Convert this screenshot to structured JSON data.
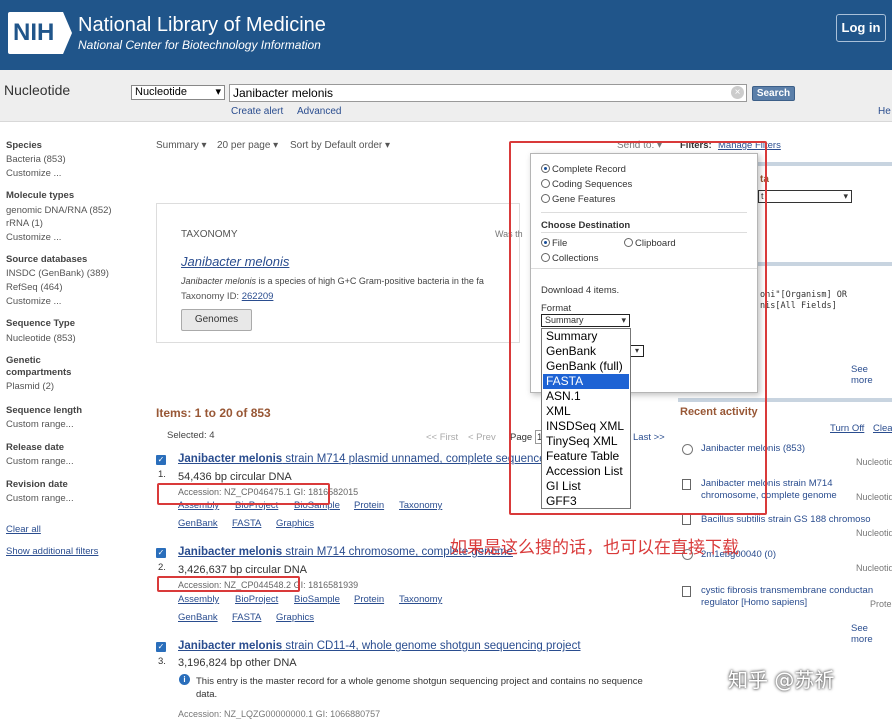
{
  "header": {
    "logo": "NIH",
    "org": "National Library of Medicine",
    "sub": "National Center for Biotechnology Information",
    "login": "Log in"
  },
  "search": {
    "db_name": "Nucleotide",
    "db_select": "Nucleotide",
    "query": "Janibacter melonis",
    "button": "Search",
    "create_alert": "Create alert",
    "advanced": "Advanced",
    "help": "He"
  },
  "filters": {
    "species_h": "Species",
    "species": [
      "Bacteria (853)",
      "Customize ..."
    ],
    "mol_h": "Molecule types",
    "mol": [
      "genomic DNA/RNA (852)",
      "rRNA (1)",
      "Customize ..."
    ],
    "src_h": "Source databases",
    "src": [
      "INSDC (GenBank) (389)",
      "RefSeq (464)",
      "Customize ..."
    ],
    "seqtype_h": "Sequence Type",
    "seqtype": [
      "Nucleotide (853)"
    ],
    "genetic_h1": "Genetic",
    "genetic_h2": "compartments",
    "genetic": [
      "Plasmid (2)"
    ],
    "seqlen_h": "Sequence length",
    "seqlen": [
      "Custom range..."
    ],
    "release_h": "Release date",
    "release": [
      "Custom range..."
    ],
    "revision_h": "Revision date",
    "revision": [
      "Custom range..."
    ],
    "clear_all": "Clear all",
    "show_add": "Show additional filters"
  },
  "toolbar": {
    "summary": "Summary ▾",
    "perpage": "20 per page ▾",
    "sort": "Sort by Default order ▾",
    "send_to": "Send to: ▾",
    "filters_label": "Filters:",
    "manage_filters": "Manage Filters"
  },
  "taxonomy": {
    "label": "TAXONOMY",
    "name": "Janibacter melonis",
    "desc_name": "Janibacter melonis",
    "desc": " is a species of high G+C Gram-positive bacteria in the fa",
    "id_label": "Taxonomy ID: ",
    "id": "262209",
    "button": "Genomes",
    "was": "Was th"
  },
  "results": {
    "items": "Items: 1 to 20 of 853",
    "selected": "Selected: 4",
    "first": "<< First",
    "prev": "< Prev",
    "page": "Page",
    "page_val": "1",
    "last": "Last >>",
    "list": [
      {
        "num": "1.",
        "title_b": "Janibacter melonis",
        "title_r": " strain M714 plasmid unnamed, complete sequence",
        "size": "54,436 bp circular DNA",
        "acc": "Accession: NZ_CP046475.1   GI: 1816582015",
        "links": [
          "Assembly",
          "BioProject",
          "BioSample",
          "Protein",
          "Taxonomy"
        ],
        "links2": [
          "GenBank",
          "FASTA",
          "Graphics"
        ]
      },
      {
        "num": "2.",
        "title_b": "Janibacter melonis",
        "title_r": " strain M714 chromosome, complete genome",
        "size": "3,426,637 bp circular DNA",
        "acc": "Accession: NZ_CP044548.2   GI: 1816581939",
        "links": [
          "Assembly",
          "BioProject",
          "BioSample",
          "Protein",
          "Taxonomy"
        ],
        "links2": [
          "GenBank",
          "FASTA",
          "Graphics"
        ]
      },
      {
        "num": "3.",
        "title_b": "Janibacter melonis",
        "title_r": " strain CD11-4, whole genome shotgun sequencing project",
        "size": "3,196,824 bp other DNA",
        "info": "This entry is the master record for a whole genome shotgun sequencing project and contains no sequence data.",
        "acc": "Accession: NZ_LQZG00000000.1   GI: 1066880757"
      }
    ]
  },
  "popup": {
    "opt1": "Complete Record",
    "opt2": "Coding Sequences",
    "opt3": "Gene Features",
    "dest_h": "Choose Destination",
    "file": "File",
    "clipboard": "Clipboard",
    "collections": "Collections",
    "download": "Download 4 items.",
    "format_h": "Format",
    "format_val": "Summary",
    "formats": [
      "Summary",
      "GenBank",
      "GenBank (full)",
      "FASTA",
      "ASN.1",
      "XML",
      "INSDSeq XML",
      "TinySeq XML",
      "Feature Table",
      "Accession List",
      "GI List",
      "GFF3"
    ],
    "selected_format": "FASTA"
  },
  "right": {
    "box1_frag": "ta",
    "box1_sel": "t",
    "box2_line1": "oni\"[Organism] OR",
    "box2_line2": "nis[All Fields]",
    "see_more": "See more",
    "recent_head": "Recent activity",
    "turn_off": "Turn Off",
    "clear": "Clea",
    "activity": [
      {
        "text": "Janibacter melonis (853)",
        "src": "Nucleotid"
      },
      {
        "text": "Janibacter melonis strain M714 chromosome, complete genome",
        "src": "Nucleotid"
      },
      {
        "text": "Bacillus subtilis strain GS 188 chromoso",
        "src": "Nucleotid"
      },
      {
        "text": "2m1ebg00040 (0)",
        "src": "Nucleotid"
      },
      {
        "text": "cystic fibrosis transmembrane conductan regulator [Homo sapiens]",
        "src": "Prote"
      }
    ],
    "see_more2": "See more"
  },
  "annotation": {
    "text": "如果是这么搜的话，也可以在直接下载",
    "color": "#d93a3a"
  },
  "watermark": "知乎 @苏祈"
}
